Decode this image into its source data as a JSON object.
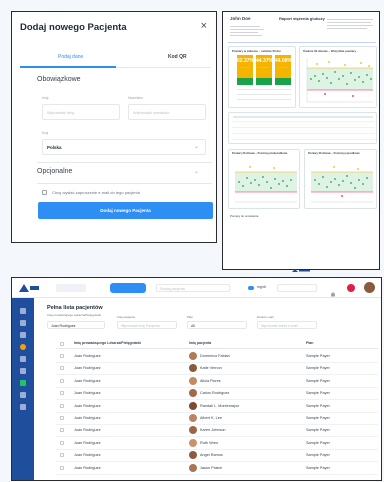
{
  "form": {
    "title": "Dodaj nowego Pacjenta",
    "close_icon": "×",
    "tabs": [
      {
        "label": "Podaj dane"
      },
      {
        "label": "Kod QR"
      }
    ],
    "required_section": "Obowiązkowe",
    "first_name": {
      "label": "Imię",
      "placeholder": "Wprowadź imię"
    },
    "last_name": {
      "label": "Nazwisko",
      "placeholder": "Wprowadź nazwisko"
    },
    "country": {
      "label": "Kraj",
      "value": "Polska"
    },
    "optional_section": "Opcjonalne",
    "invite_checkbox_label": "Chcę wysłać zaproszenie e-mail do tego pacjenta",
    "submit_label": "Dodaj nowego Pacjenta",
    "accent_color": "#2e8ef3"
  },
  "report": {
    "patient_name": "John Doe",
    "title": "Raport stężenia glukozy",
    "stats_box_title": "Pomiary w zakresie – ostatnie 30 dni",
    "tiles": [
      {
        "value": "62.37%",
        "color": "#f4b400"
      },
      {
        "value": "44.37%",
        "color": "#f4b400"
      },
      {
        "value": "44.08%",
        "color": "#f4b400"
      }
    ],
    "chart_box_title": "Średnie 30-dniowe – Wszystkie pomiary",
    "bottom_left_title": "Pomiary 30-dniowe – Poziomy przedposiłkowe",
    "bottom_right_title": "Pomiary 30-dniowe – Poziomy poposiłkowe",
    "footer_note": "Pomiary do omówienia"
  },
  "app": {
    "brand_icon": "logo-icon",
    "page_title": "Pełna lista pacjentów",
    "search_placeholder": "Szukaj pacjenta",
    "unit_label": "mg/dl",
    "filters": {
      "doctor_label": "Imię prowadzącego Lekarza/Pielęgniarki",
      "doctor_value": "Juan Rodriguez",
      "patient_label": "Imię pacjenta",
      "patient_placeholder": "Wprowadź imię Pacjenta",
      "plan_label": "Plan",
      "plan_value": "All",
      "email_label": "Email e-mail",
      "email_placeholder": "Wprowadź adres e-mail"
    },
    "columns": {
      "doctor": "Imię prowadzącego Lekarza/Pielęgniarki",
      "patient": "Imię pacjenta",
      "plan": "Plan"
    },
    "rows": [
      {
        "doctor": "Juan Rodriguez",
        "patient": "Domenico Fabian",
        "plan": "Sample Payer"
      },
      {
        "doctor": "Juan Rodriguez",
        "patient": "Katie Vernon",
        "plan": "Sample Payer"
      },
      {
        "doctor": "Juan Rodriguez",
        "patient": "Alicia Flores",
        "plan": "Sample Payer"
      },
      {
        "doctor": "Juan Rodriguez",
        "patient": "Carlos Rodriguez",
        "plan": "Sample Payer"
      },
      {
        "doctor": "Juan Rodriguez",
        "patient": "Randall L. Montemayor",
        "plan": "Sample Payer"
      },
      {
        "doctor": "Juan Rodriguez",
        "patient": "Albert K. Lee",
        "plan": "Sample Payer"
      },
      {
        "doctor": "Juan Rodriguez",
        "patient": "Karen Johnson",
        "plan": "Sample Payer"
      },
      {
        "doctor": "Juan Rodriguez",
        "patient": "Ruth Wren",
        "plan": "Sample Payer"
      },
      {
        "doctor": "Juan Rodriguez",
        "patient": "Angel Ramos",
        "plan": "Sample Payer"
      },
      {
        "doctor": "Juan Rodriguez",
        "patient": "Jason Pratce",
        "plan": "Sample Payer"
      }
    ]
  }
}
